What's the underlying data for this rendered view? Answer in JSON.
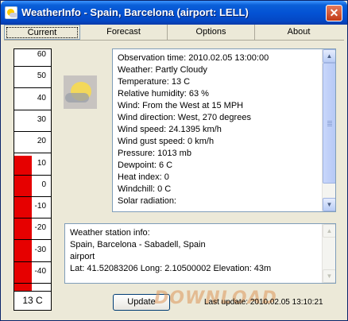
{
  "window": {
    "title": "WeatherInfo - Spain, Barcelona (airport: LELL)"
  },
  "tabs": [
    {
      "label": "Current",
      "active": true
    },
    {
      "label": "Forecast",
      "active": false
    },
    {
      "label": "Options",
      "active": false
    },
    {
      "label": "About",
      "active": false
    }
  ],
  "thermometer": {
    "scale": [
      "60",
      "50",
      "40",
      "30",
      "20",
      "10",
      "0",
      "-10",
      "-20",
      "-30",
      "-40"
    ],
    "scale_min": -45,
    "scale_max": 60,
    "temperature_value": 13,
    "readout": "13 C",
    "mercury_color": "#e60000"
  },
  "weather_icon": "partly-cloudy-icon",
  "observation": [
    "Observation time: 2010.02.05 13:00:00",
    "Weather: Partly Cloudy",
    "Temperature: 13 C",
    "Relative humidity: 63 %",
    "Wind: From the West at 15 MPH",
    "Wind direction: West,  270 degrees",
    "Wind speed: 24.1395 km/h",
    "Wind gust speed: 0 km/h",
    "Pressure: 1013 mb",
    "Dewpoint: 6 C",
    "Heat index: 0",
    "Windchill: 0 C",
    "Solar radiation:"
  ],
  "station": [
    "Weather station info:",
    "Spain, Barcelona - Sabadell, Spain",
    "airport",
    "Lat: 41.52083206 Long: 2.10500002 Elevation: 43m"
  ],
  "update_button": "Update",
  "last_update": "Last update: 2010.02.05 13:10:21",
  "watermark": "DOWNLOAD"
}
